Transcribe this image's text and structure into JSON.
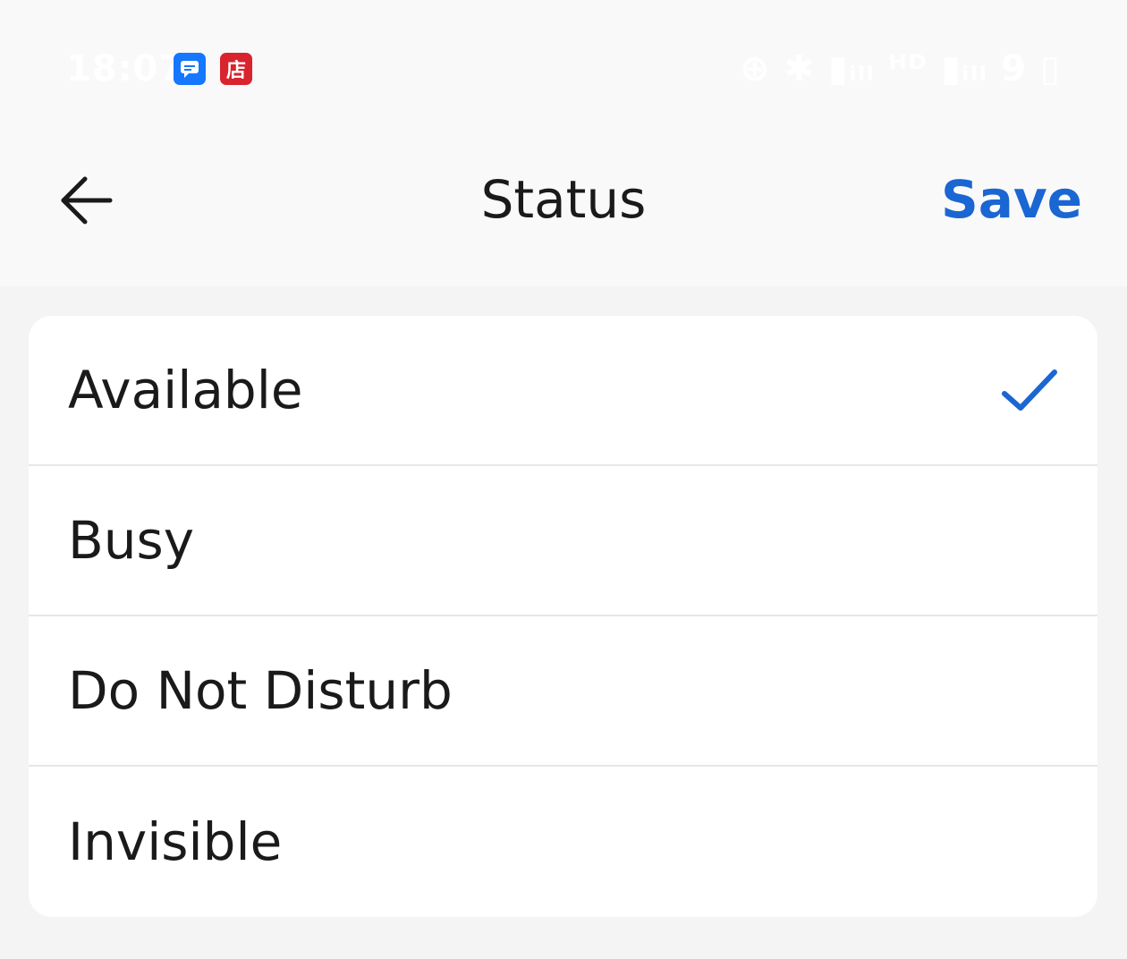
{
  "status_bar": {
    "time": "18:07",
    "indicators": "⊕ ✱ ▮ᵢₗₗ ᴴᴰ ▮ᵢₗₗ 9 ▯",
    "notification_icons": [
      "chat-app-icon",
      "store-app-icon"
    ],
    "store_glyph": "店"
  },
  "header": {
    "back_icon": "arrow-left-icon",
    "title": "Status",
    "save_label": "Save"
  },
  "options": [
    {
      "label": "Available",
      "selected": true
    },
    {
      "label": "Busy",
      "selected": false
    },
    {
      "label": "Do Not Disturb",
      "selected": false
    },
    {
      "label": "Invisible",
      "selected": false
    }
  ],
  "colors": {
    "accent": "#1a66d2",
    "page_bg": "#f4f4f4",
    "bar_bg": "#f9f9f9",
    "card_bg": "#ffffff",
    "divider": "#e6e6e6"
  }
}
